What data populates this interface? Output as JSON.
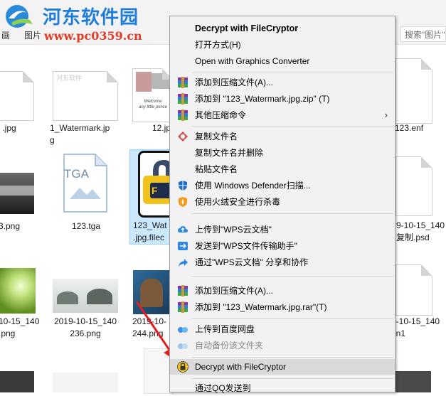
{
  "watermark": {
    "title": "河东软件园",
    "url": "www.pc0359.cn"
  },
  "breadcrumb": {
    "a": "画",
    "b": "图片"
  },
  "search": {
    "placeholder": "搜索\"图片\""
  },
  "files": [
    {
      "label": ".jpg"
    },
    {
      "label": "1_Watermark.jp\ng"
    },
    {
      "label": "12.jp"
    },
    {
      "label": "123.enf"
    },
    {
      "label": "3.png"
    },
    {
      "label": "123.tga"
    },
    {
      "label": "123_Wat\n.jpg.filec"
    },
    {
      "label": "9-10-15_140\n复制.psd"
    },
    {
      "label": "10-15_140\n.png"
    },
    {
      "label": "2019-10-15_140\n236.png"
    },
    {
      "label": "2019-10-\n244.png"
    },
    {
      "label": "9-10-15_140\non1"
    }
  ],
  "tga_badge": "TGA",
  "thumb_text": {
    "watermark": "河东软件",
    "welcome": "Welcome\nany little prince"
  },
  "menu": {
    "items": [
      {
        "label": "Decrypt with FileCryptor"
      },
      {
        "label": "打开方式(H)"
      },
      {
        "label": "Open with Graphics Converter"
      },
      {
        "label": "添加到压缩文件(A)..."
      },
      {
        "label": "添加到 \"123_Watermark.jpg.zip\" (T)"
      },
      {
        "label": "其他压缩命令"
      },
      {
        "label": "复制文件名"
      },
      {
        "label": "复制文件名并删除"
      },
      {
        "label": "粘贴文件名"
      },
      {
        "label": "使用 Windows Defender扫描..."
      },
      {
        "label": "使用火绒安全进行杀毒"
      },
      {
        "label": "上传到\"WPS云文档\""
      },
      {
        "label": "发送到\"WPS文件传输助手\""
      },
      {
        "label": "通过\"WPS云文档\" 分享和协作"
      },
      {
        "label": "添加到压缩文件(A)..."
      },
      {
        "label": "添加到 \"123_Watermark.jpg.rar\"(T)"
      },
      {
        "label": "上传到百度网盘"
      },
      {
        "label": "自动备份该文件夹"
      },
      {
        "label": "Decrypt with FileCryptor"
      },
      {
        "label": "通过QQ发送到"
      }
    ]
  }
}
